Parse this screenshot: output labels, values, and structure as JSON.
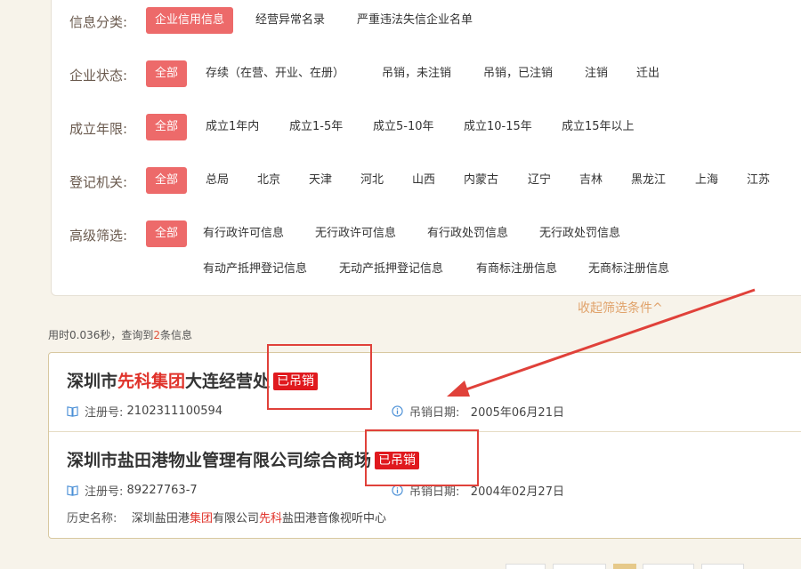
{
  "filters": {
    "category": {
      "label": "信息分类:",
      "options": [
        "企业信用信息",
        "经营异常名录",
        "严重违法失信企业名单"
      ]
    },
    "status": {
      "label": "企业状态:",
      "options": [
        "全部",
        "存续（在营、开业、在册）",
        "吊销，未注销",
        "吊销，已注销",
        "注销",
        "迁出"
      ]
    },
    "years": {
      "label": "成立年限:",
      "options": [
        "全部",
        "成立1年内",
        "成立1-5年",
        "成立5-10年",
        "成立10-15年",
        "成立15年以上"
      ]
    },
    "authority": {
      "label": "登记机关:",
      "options": [
        "全部",
        "总局",
        "北京",
        "天津",
        "河北",
        "山西",
        "内蒙古",
        "辽宁",
        "吉林",
        "黑龙江",
        "上海",
        "江苏"
      ]
    },
    "advanced": {
      "label": "高级筛选:",
      "options": [
        "全部",
        "有行政许可信息",
        "无行政许可信息",
        "有行政处罚信息",
        "无行政处罚信息",
        "有动产抵押登记信息",
        "无动产抵押登记信息",
        "有商标注册信息",
        "无商标注册信息"
      ]
    }
  },
  "collapse_label": "收起筛选条件^",
  "stats": {
    "prefix": "用时0.036秒，查询到",
    "count": "2",
    "suffix": "条信息"
  },
  "results": [
    {
      "title_parts": [
        "深圳市",
        "先科集团",
        "大连经营处"
      ],
      "badge": "已吊销",
      "reg_label": "注册号:",
      "reg_no": "2102311100594",
      "date_label": "吊销日期:",
      "date": "2005年06月21日"
    },
    {
      "title": "深圳市盐田港物业管理有限公司综合商场",
      "badge": "已吊销",
      "reg_label": "注册号:",
      "reg_no": "89227763-7",
      "date_label": "吊销日期:",
      "date": "2004年02月27日",
      "history_label": "历史名称:",
      "history_parts": [
        "深圳盐田港",
        "集团",
        "有限公司",
        "先科",
        "盐田港音像视听中心"
      ]
    }
  ],
  "colors": {
    "accent": "#ed6a6a",
    "highlight": "#e0322a",
    "badge": "#e0191e",
    "annotation": "#e0413a",
    "link": "#e0a26a"
  }
}
